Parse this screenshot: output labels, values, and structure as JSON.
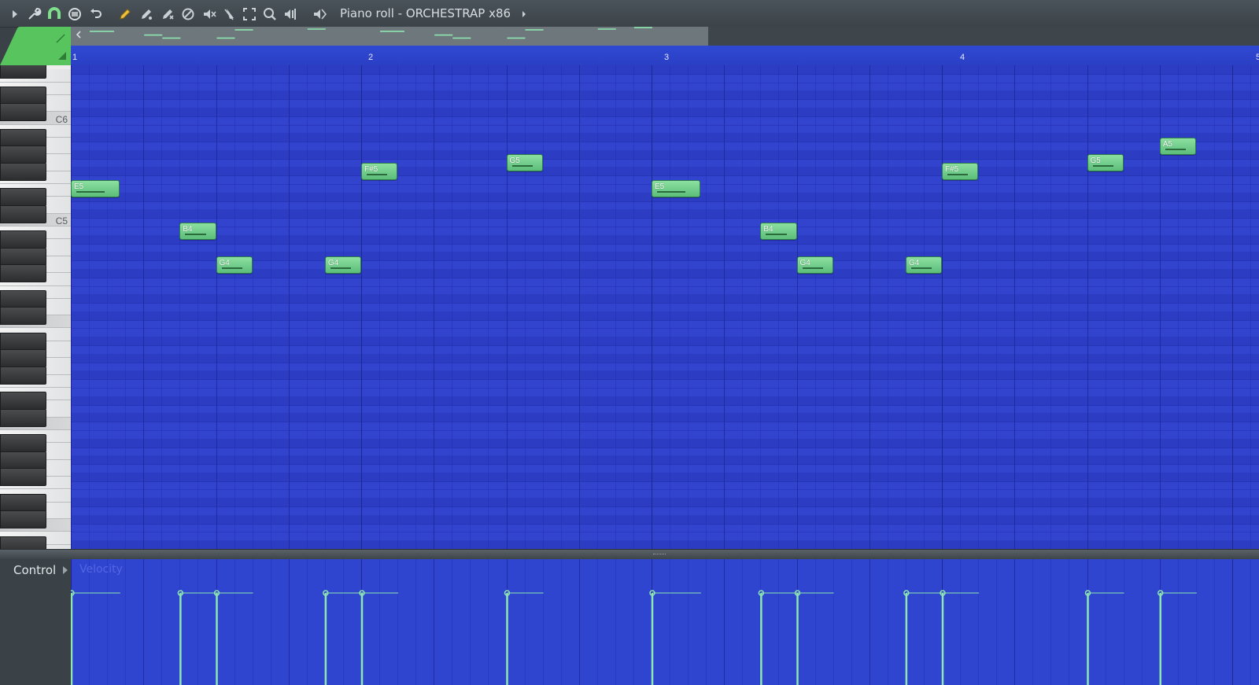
{
  "toolbar": {
    "title": "Piano roll - ORCHESTRAP x86",
    "icons": [
      "play-menu-arrow-icon",
      "wrench-icon",
      "magnet-snap-icon",
      "stamp-icon",
      "undo-icon",
      "pencil-icon",
      "paint-brush-icon",
      "delete-tool-icon",
      "mute-tool-icon",
      "mute-speaker-icon",
      "slice-tool-icon",
      "select-tool-icon",
      "zoom-tool-icon",
      "playback-tool-icon",
      "speaker-icon",
      "title-arrow-icon"
    ]
  },
  "ruler": {
    "bars": [
      "1",
      "2",
      "3",
      "4",
      "5"
    ]
  },
  "keyboard": {
    "labels": {
      "c6": "C6",
      "c5": "C5"
    }
  },
  "notes": [
    {
      "pitch": "E5",
      "start_beat": 0.0,
      "length_beats": 0.67
    },
    {
      "pitch": "B4",
      "start_beat": 1.5,
      "length_beats": 0.5
    },
    {
      "pitch": "G4",
      "start_beat": 2.0,
      "length_beats": 0.5
    },
    {
      "pitch": "G4",
      "start_beat": 3.5,
      "length_beats": 0.5
    },
    {
      "pitch": "F#5",
      "start_beat": 4.0,
      "length_beats": 0.5
    },
    {
      "pitch": "G5",
      "start_beat": 6.0,
      "length_beats": 0.5
    },
    {
      "pitch": "E5",
      "start_beat": 8.0,
      "length_beats": 0.67
    },
    {
      "pitch": "B4",
      "start_beat": 9.5,
      "length_beats": 0.5
    },
    {
      "pitch": "G4",
      "start_beat": 10.0,
      "length_beats": 0.5
    },
    {
      "pitch": "G4",
      "start_beat": 11.5,
      "length_beats": 0.5
    },
    {
      "pitch": "F#5",
      "start_beat": 12.0,
      "length_beats": 0.5
    },
    {
      "pitch": "G5",
      "start_beat": 14.0,
      "length_beats": 0.5
    },
    {
      "pitch": "A5",
      "start_beat": 15.0,
      "length_beats": 0.5
    }
  ],
  "control": {
    "label": "Control",
    "parameter": "Velocity"
  },
  "colors": {
    "grid": "#3243ce",
    "note": "#6fd08a",
    "velocity_line": "#8ee6b0"
  }
}
